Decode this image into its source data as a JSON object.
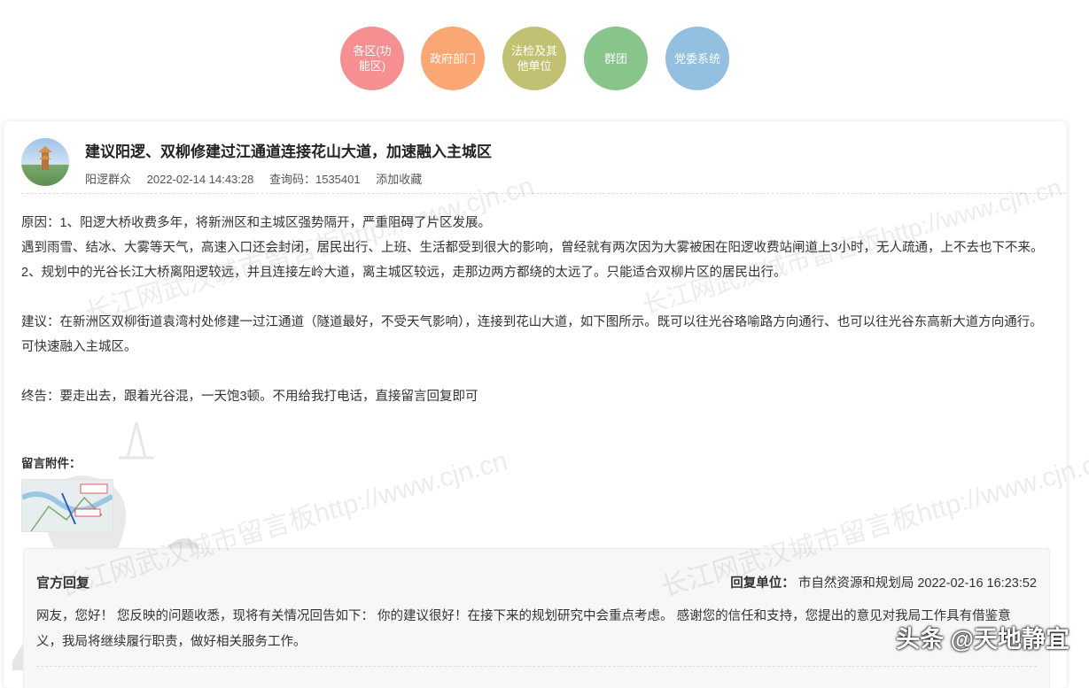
{
  "nav": {
    "items": [
      {
        "label": "各区(功能区)",
        "color": "#f58f91"
      },
      {
        "label": "政府部门",
        "color": "#fba774"
      },
      {
        "label": "法检及其他单位",
        "color": "#c2c173"
      },
      {
        "label": "群团",
        "color": "#88c58b"
      },
      {
        "label": "党委系统",
        "color": "#93bfe0"
      }
    ]
  },
  "post": {
    "title": "建议阳逻、双柳修建过江通道连接花山大道，加速融入主城区",
    "author": "阳逻群众",
    "datetime": "2022-02-14 14:43:28",
    "query_code": "查询码：1535401",
    "favorite": "添加收藏",
    "paragraphs": [
      "原因：1、阳逻大桥收费多年，将新洲区和主城区强势隔开，严重阻碍了片区发展。",
      "遇到雨雪、结冰、大雾等天气，高速入口还会封闭，居民出行、上班、生活都受到很大的影响，曾经就有两次因为大雾被困在阳逻收费站闸道上3小时，无人疏通，上不去也下不来。",
      "2、规划中的光谷长江大桥离阳逻较远，并且连接左岭大道，离主城区较远，走那边两方都绕的太远了。只能适合双柳片区的居民出行。",
      "",
      "建议：在新洲区双柳街道袁湾村处修建一过江通道（隧道最好，不受天气影响），连接到花山大道，如下图所示。既可以往光谷珞喻路方向通行、也可以往光谷东高新大道方向通行。可快速融入主城区。",
      "",
      "终告：要走出去，跟着光谷混，一天饱3顿。不用给我打电话，直接留言回复即可"
    ],
    "attachment_label": "留言附件："
  },
  "reply": {
    "heading": "官方回复",
    "unit_label": "回复单位：",
    "unit": "市自然资源和规划局 2022-02-16 16:23:52",
    "body": "网友，您好！ 您反映的问题收悉，现将有关情况回告如下： 你的建议很好！在接下来的规划研究中会重点考虑。 感谢您的信任和支持，您提出的意见对我局工作具有借鉴意义，我局将继续履行职责，做好相关服务工作。"
  },
  "watermarks": {
    "site": "长江网武汉城市留言板http://www.cjn.cn",
    "corner": "头条 @天地静宜"
  }
}
